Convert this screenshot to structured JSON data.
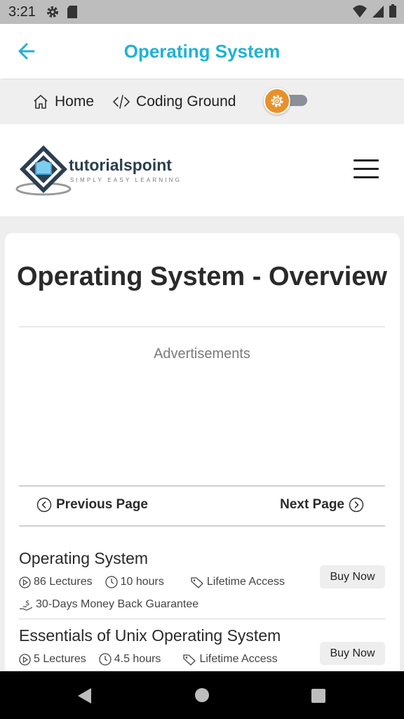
{
  "status_bar": {
    "time": "3:21"
  },
  "app_bar": {
    "title": "Operating System"
  },
  "breadcrumbs": {
    "home": "Home",
    "coding_ground": "Coding Ground"
  },
  "logo": {
    "brand": "tutorialspoint",
    "tagline": "SIMPLY EASY LEARNING"
  },
  "article": {
    "heading": "Operating System - Overview",
    "ads_label": "Advertisements"
  },
  "pager": {
    "previous": "Previous Page",
    "next": "Next Page"
  },
  "courses": [
    {
      "title": "Operating System",
      "lectures": "86 Lectures",
      "hours": "10 hours",
      "access": "Lifetime Access",
      "guarantee": "30-Days Money Back Guarantee",
      "buy_label": "Buy Now"
    },
    {
      "title": "Essentials of Unix Operating System",
      "lectures": "5 Lectures",
      "hours": "4.5 hours",
      "access": "Lifetime Access",
      "buy_label": "Buy Now"
    }
  ],
  "colors": {
    "accent": "#1fb3d2",
    "toggle_knob": "#e8912b",
    "nav_bar": "#000000"
  },
  "icons": {
    "back": "arrow-left-icon",
    "home": "home-icon",
    "code": "code-icon",
    "theme": "gear-icon",
    "menu": "hamburger-icon",
    "prev": "chevron-left-circle-icon",
    "next": "chevron-right-circle-icon",
    "lectures": "play-circle-icon",
    "hours": "clock-icon",
    "access": "tag-icon",
    "guarantee": "money-hand-icon"
  }
}
